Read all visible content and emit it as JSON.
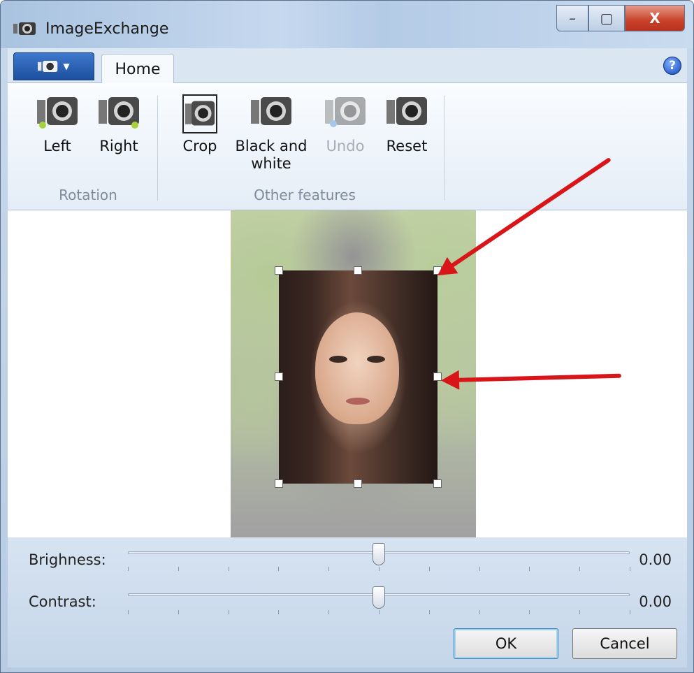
{
  "window": {
    "title": "ImageExchange",
    "minimize": "–",
    "maximize": "▢",
    "close": "X"
  },
  "ribbon": {
    "tab": "Home",
    "help": "?",
    "buttons": {
      "left": "Left",
      "right": "Right",
      "crop": "Crop",
      "bw_line1": "Black and",
      "bw_line2": "white",
      "undo": "Undo",
      "reset": "Reset"
    },
    "groups": {
      "rotation": "Rotation",
      "other": "Other features"
    }
  },
  "sliders": {
    "brightness": {
      "label": "Brighness:",
      "value": "0.00",
      "level": 0.5
    },
    "contrast": {
      "label": "Contrast:",
      "value": "0.00",
      "level": 0.5
    }
  },
  "buttons": {
    "ok": "OK",
    "cancel": "Cancel"
  },
  "colors": {
    "accent": "#1c4f9f",
    "annotation": "#d8161a"
  },
  "icons": [
    "camera-icon",
    "help-icon"
  ]
}
